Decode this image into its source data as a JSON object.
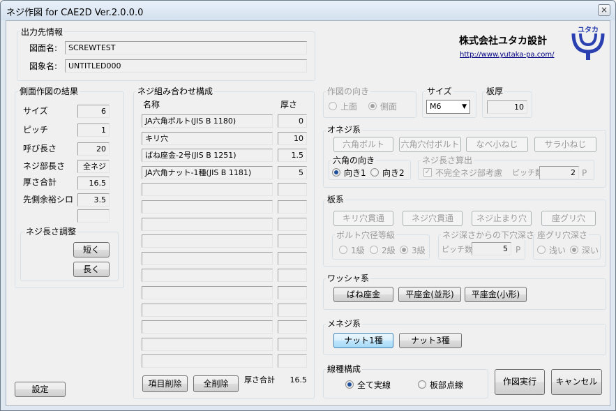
{
  "window": {
    "title": "ネジ作図 for CAE2D Ver.2.0.0.0",
    "close": "×"
  },
  "output": {
    "label": "出力先情報",
    "drawing_name_label": "図面名:",
    "drawing_name": "SCREWTEST",
    "symbol_name_label": "図象名:",
    "symbol_name": "UNTITLED000"
  },
  "company": {
    "name": "株式会社ユタカ設計",
    "url": "http://www.yutaka-pa.com/",
    "logo_text": "ユタカ"
  },
  "result": {
    "label": "側面作図の結果",
    "rows": [
      {
        "label": "サイズ",
        "value": "6"
      },
      {
        "label": "ピッチ",
        "value": "1"
      },
      {
        "label": "呼び長さ",
        "value": "20"
      },
      {
        "label": "ネジ部長さ",
        "value": "全ネジ"
      },
      {
        "label": "厚さ合計",
        "value": "16.5"
      },
      {
        "label": "先側余裕シロ",
        "value": "3.5"
      },
      {
        "label": "",
        "value": ""
      }
    ],
    "adjust_label": "ネジ長さ調整",
    "shorter": "短く",
    "longer": "長く"
  },
  "settings_button": "設定",
  "combo": {
    "label": "ネジ組み合わせ構成",
    "col_name": "名称",
    "col_thickness": "厚さ",
    "rows": [
      {
        "name": "JA六角ボルト(JIS B 1180)",
        "thickness": "0"
      },
      {
        "name": "キリ穴",
        "thickness": "10"
      },
      {
        "name": "ばね座金-2号(JIS B 1251)",
        "thickness": "1.5"
      },
      {
        "name": "JA六角ナット-1種(JIS B 1181)",
        "thickness": "5"
      },
      {
        "name": "",
        "thickness": ""
      },
      {
        "name": "",
        "thickness": ""
      },
      {
        "name": "",
        "thickness": ""
      },
      {
        "name": "",
        "thickness": ""
      },
      {
        "name": "",
        "thickness": ""
      },
      {
        "name": "",
        "thickness": ""
      },
      {
        "name": "",
        "thickness": ""
      },
      {
        "name": "",
        "thickness": ""
      },
      {
        "name": "",
        "thickness": ""
      },
      {
        "name": "",
        "thickness": ""
      },
      {
        "name": "",
        "thickness": ""
      }
    ],
    "delete_item": "項目削除",
    "delete_all": "全削除",
    "total_label": "厚さ合計",
    "total_value": "16.5"
  },
  "direction": {
    "label": "作図の向き",
    "top": "上面",
    "side": "側面",
    "selected": "側面"
  },
  "size": {
    "label": "サイズ",
    "value": "M6"
  },
  "plate": {
    "label": "板厚",
    "value": "10"
  },
  "male": {
    "label": "オネジ系",
    "buttons": [
      "六角ボルト",
      "六角穴付ボルト",
      "なべ小ねじ",
      "サラ小ねじ"
    ],
    "hex_dir_label": "六角の向き",
    "dir1": "向き1",
    "dir2": "向き2",
    "calc_label": "ネジ長さ算出",
    "incomplete": "不完全ネジ部考慮",
    "pitch_label": "ピッチ数",
    "pitch_value": "2",
    "pitch_unit": "P"
  },
  "platesys": {
    "label": "板系",
    "buttons": [
      "キリ穴貫通",
      "ネジ穴貫通",
      "ネジ止まり穴",
      "座グリ穴"
    ],
    "grade_label": "ボルト穴径等級",
    "grades": [
      "1級",
      "2級",
      "3級"
    ],
    "depth_label": "ネジ深さからの下穴深さ",
    "pitch_label": "ピッチ数",
    "pitch_value": "5",
    "pitch_unit": "P",
    "counter_label": "座グリ穴深さ",
    "shallow": "浅い",
    "deep": "深い"
  },
  "washer": {
    "label": "ワッシャ系",
    "buttons": [
      "ばね座金",
      "平座金(並形)",
      "平座金(小形)"
    ]
  },
  "female": {
    "label": "メネジ系",
    "buttons": [
      "ナット1種",
      "ナット3種"
    ]
  },
  "line": {
    "label": "線種構成",
    "all_solid": "全て実線",
    "plate_dotted": "板部点線"
  },
  "execute": "作図実行",
  "cancel": "キャンセル"
}
